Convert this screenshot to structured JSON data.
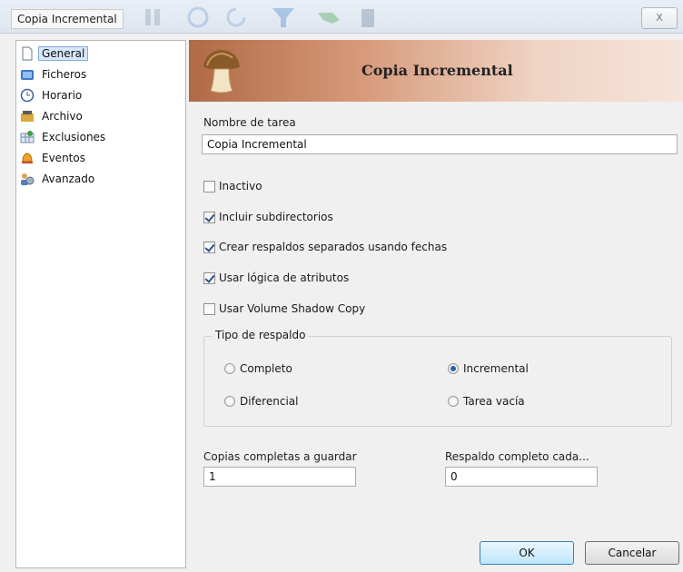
{
  "window": {
    "title": "Copia Incremental",
    "close_label": "X"
  },
  "sidebar": {
    "items": [
      {
        "label": "General",
        "icon": "page-icon",
        "active": true
      },
      {
        "label": "Ficheros",
        "icon": "files-icon"
      },
      {
        "label": "Horario",
        "icon": "clock-icon"
      },
      {
        "label": "Archivo",
        "icon": "archive-icon"
      },
      {
        "label": "Exclusiones",
        "icon": "exclusions-icon"
      },
      {
        "label": "Eventos",
        "icon": "bell-icon"
      },
      {
        "label": "Avanzado",
        "icon": "advanced-icon"
      }
    ]
  },
  "banner": {
    "title": "Copia Incremental",
    "icon": "mushroom-icon"
  },
  "task": {
    "name_label": "Nombre de tarea",
    "name_value": "Copia Incremental"
  },
  "options": [
    {
      "label": "Inactivo",
      "checked": false
    },
    {
      "label": "Incluir subdirectorios",
      "checked": true
    },
    {
      "label": "Crear respaldos separados usando fechas",
      "checked": true
    },
    {
      "label": "Usar lógica de atributos",
      "checked": true
    },
    {
      "label": "Usar Volume Shadow Copy",
      "checked": false
    }
  ],
  "backup_type": {
    "legend": "Tipo de respaldo",
    "options": [
      {
        "label": "Completo",
        "selected": false
      },
      {
        "label": "Incremental",
        "selected": true
      },
      {
        "label": "Diferencial",
        "selected": false
      },
      {
        "label": "Tarea vacía",
        "selected": false
      }
    ]
  },
  "copies": {
    "label": "Copias completas a guardar",
    "value": "1"
  },
  "full_every": {
    "label": "Respaldo completo cada...",
    "value": "0"
  },
  "buttons": {
    "ok": "OK",
    "cancel": "Cancelar"
  },
  "colors": {
    "banner_start": "#b06a45",
    "banner_end": "#f6e4da",
    "selection": "#d7e6fb",
    "radio_dot": "#2d5fa8"
  }
}
